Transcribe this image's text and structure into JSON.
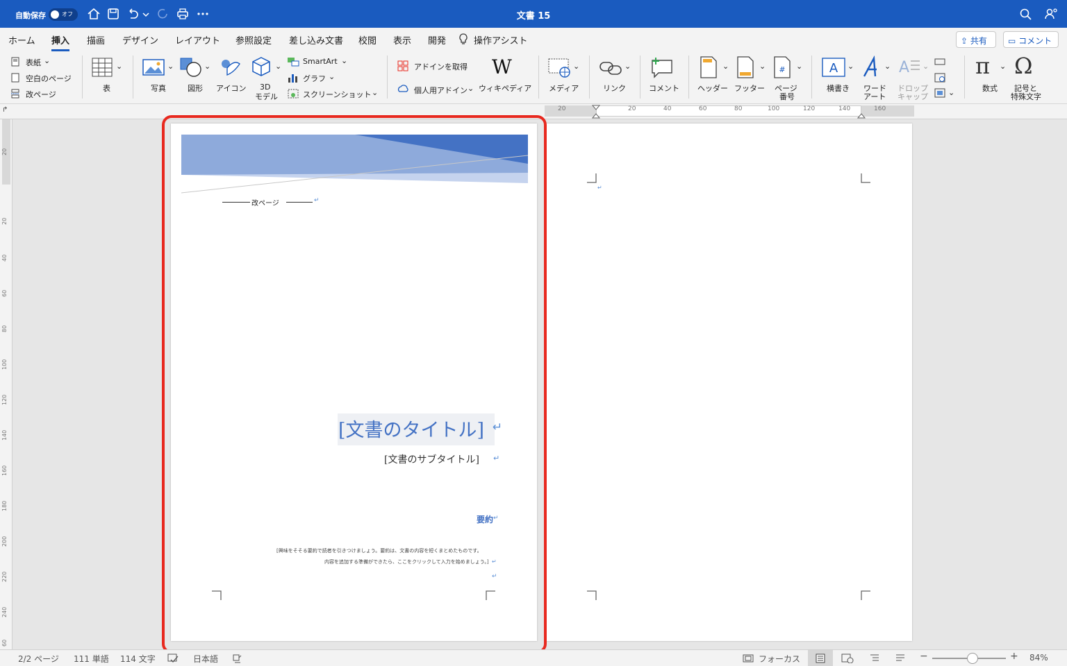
{
  "titlebar": {
    "autosave_label": "自動保存",
    "autosave_state": "オフ",
    "doc_title": "文書 15"
  },
  "tabs": {
    "items": [
      "ホーム",
      "挿入",
      "描画",
      "デザイン",
      "レイアウト",
      "参照設定",
      "差し込み文書",
      "校閲",
      "表示",
      "開発"
    ],
    "active": "挿入",
    "assist": "操作アシスト",
    "share": "共有",
    "comment": "コメント"
  },
  "ribbon": {
    "cover": "表紙",
    "blank_page": "空白のページ",
    "page_break": "改ページ",
    "table": "表",
    "photo": "写真",
    "shapes": "図形",
    "icons": "アイコン",
    "model3d_line1": "3D",
    "model3d_line2": "モデル",
    "smartart": "SmartArt",
    "chart": "グラフ",
    "screenshot": "スクリーンショット",
    "get_addins": "アドインを取得",
    "my_addins": "個人用アドイン",
    "wikipedia": "ウィキペディア",
    "media": "メディア",
    "link": "リンク",
    "comment": "コメント",
    "header": "ヘッダー",
    "footer": "フッター",
    "page_number_line1": "ページ",
    "page_number_line2": "番号",
    "textbox": "横書き",
    "wordart_line1": "ワード",
    "wordart_line2": "アート",
    "dropcap_line1": "ドロップ",
    "dropcap_line2": "キャップ",
    "equation": "数式",
    "symbol_line1": "記号と",
    "symbol_line2": "特殊文字"
  },
  "rulers": {
    "horizontal": [
      "20",
      "20",
      "40",
      "60",
      "80",
      "100",
      "120",
      "140",
      "160"
    ],
    "vertical": [
      "20",
      "20",
      "40",
      "60",
      "80",
      "100",
      "120",
      "140",
      "160",
      "180",
      "200",
      "220",
      "240",
      "60"
    ]
  },
  "document": {
    "page_break_marker": "改ページ",
    "title": "[文書のタイトル]",
    "subtitle": "[文書のサブタイトル]",
    "abstract_heading": "要約",
    "abstract_line1": "[興味をそそる要約で読者を引きつけましょう。要約は、文書の内容を短くまとめたものです。",
    "abstract_line2": "内容を追加する準備ができたら、ここをクリックして入力を始めましょう。]",
    "return_mark": "↵",
    "banner_colors": [
      "#4472c4",
      "#8eaadb",
      "#c5d3ee"
    ]
  },
  "status": {
    "page": "2/2 ページ",
    "words": "111 単語",
    "chars": "114 文字",
    "language": "日本語",
    "focus": "フォーカス",
    "zoom": "84%",
    "zoom_level": 0.55
  },
  "colors": {
    "accent": "#1a5bbf",
    "highlight": "#e8291f",
    "doc_blue": "#4472c4"
  }
}
